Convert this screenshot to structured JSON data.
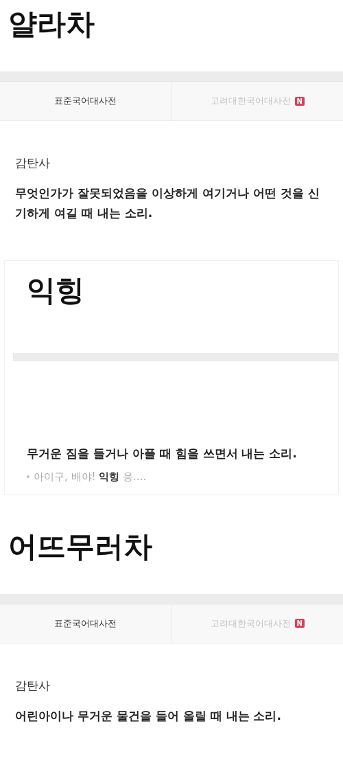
{
  "entries": [
    {
      "kind": "dictionary",
      "title": "얄라차",
      "tabs": [
        {
          "label": "표준국어대사전",
          "selected": true
        },
        {
          "label": "고려대한국어대사전",
          "selected": false,
          "badge": "N"
        }
      ],
      "part_of_speech": "감탄사",
      "definition": "무엇인가가 잘못되었음을 이상하게 여기거나 어떤 것을 신기하게 여길 때 내는 소리."
    },
    {
      "kind": "card",
      "title": "익힝",
      "definition": "무거운 짐을 들거나 아플 때 힘을 쓰면서 내는 소리.",
      "example": "아이구, 배야! **익힝** 응...."
    },
    {
      "kind": "dictionary",
      "title": "어뜨무러차",
      "tabs": [
        {
          "label": "표준국어대사전",
          "selected": true
        },
        {
          "label": "고려대한국어대사전",
          "selected": false,
          "badge": "N"
        }
      ],
      "part_of_speech": "감탄사",
      "definition": "어린아이나 무거운 물건을 들어 올릴 때 내는 소리."
    }
  ]
}
